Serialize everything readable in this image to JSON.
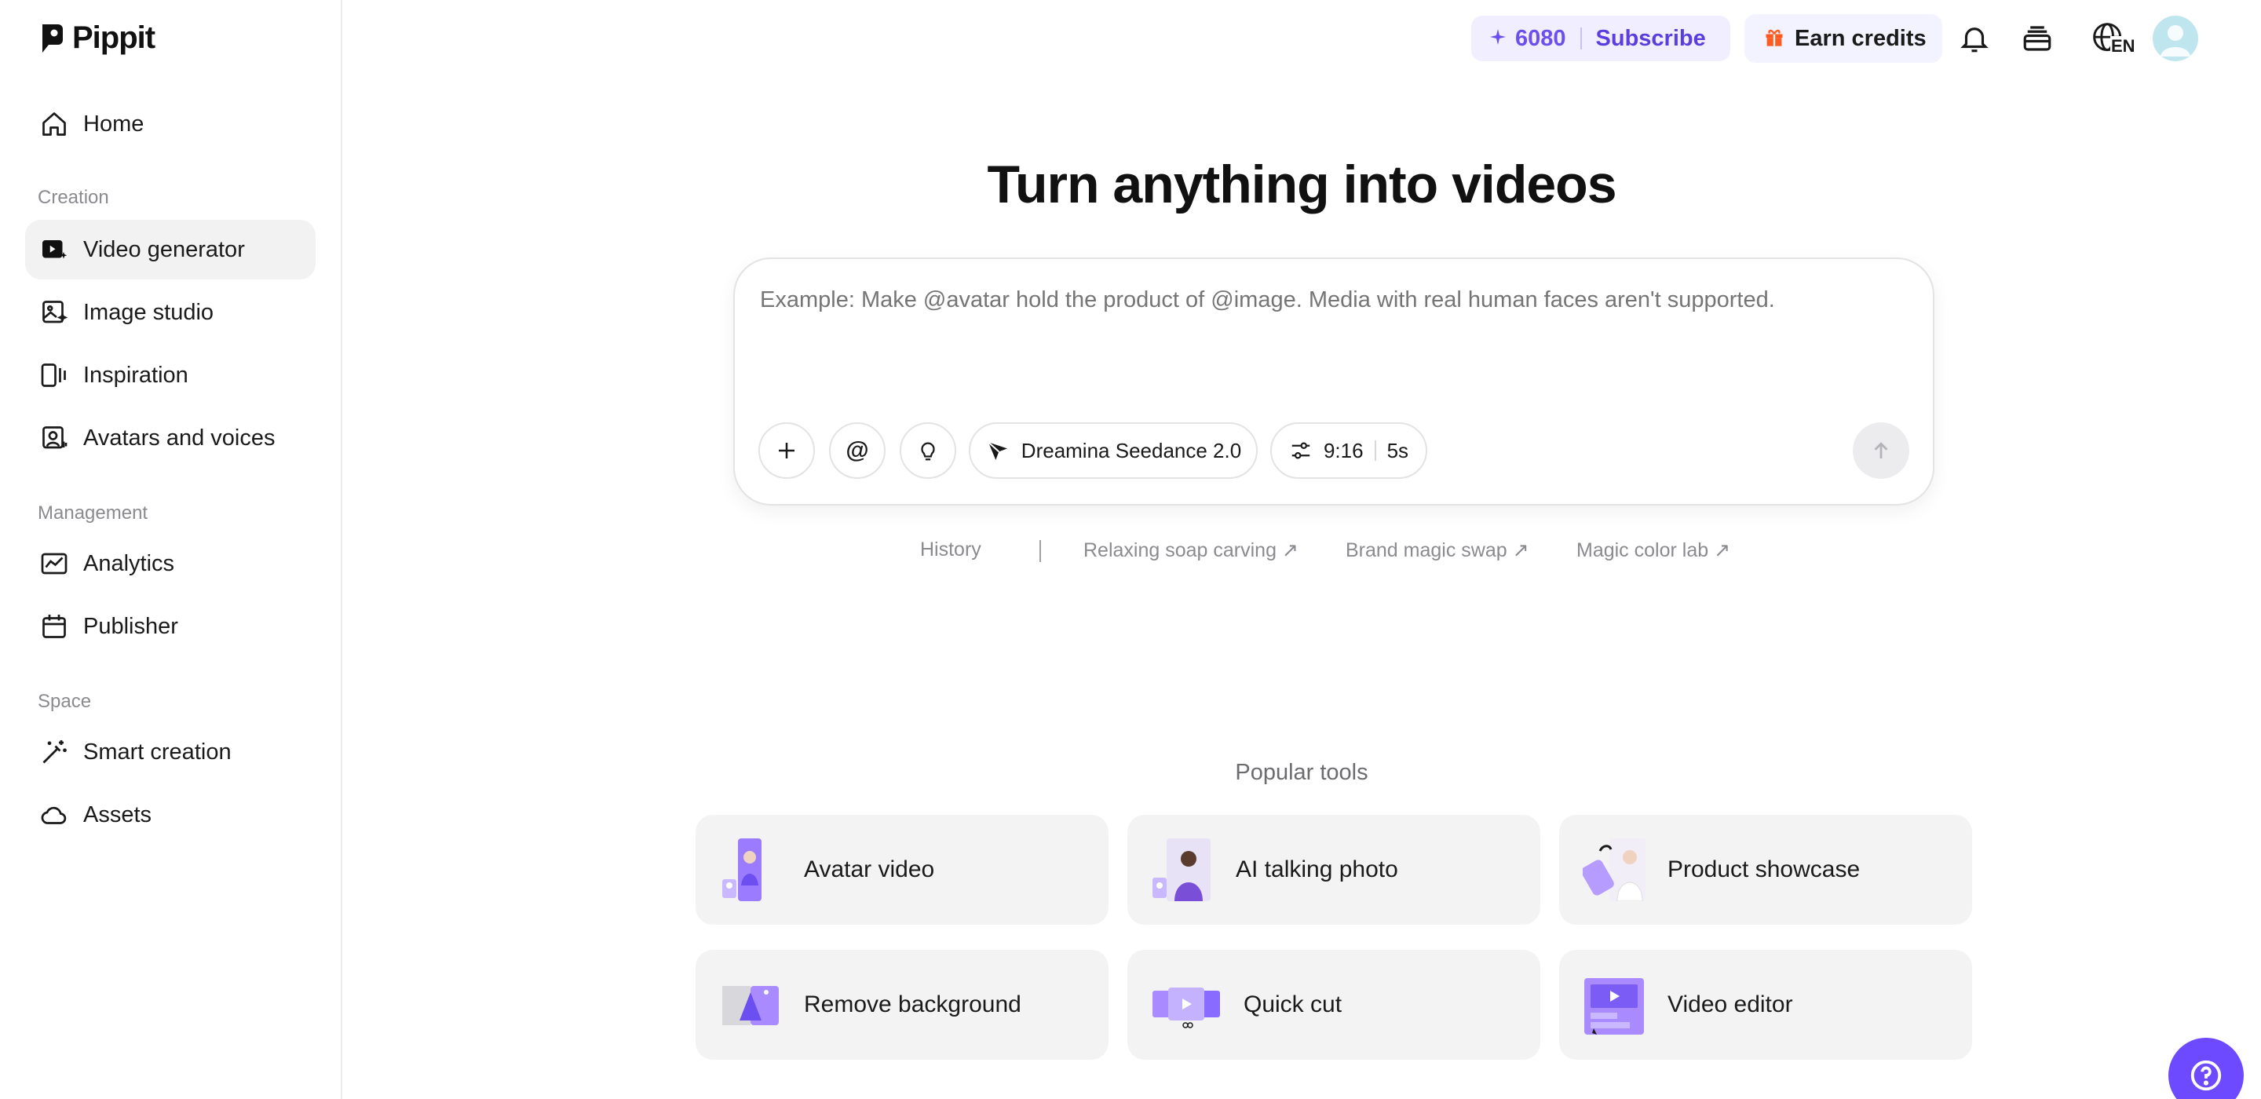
{
  "app": {
    "name": "Pippit"
  },
  "sidebar": {
    "home": "Home",
    "sections": {
      "creation": "Creation",
      "management": "Management",
      "space": "Space"
    },
    "items": [
      {
        "label": "Video generator",
        "icon": "video-generator-icon",
        "active": true
      },
      {
        "label": "Image studio",
        "icon": "image-studio-icon"
      },
      {
        "label": "Inspiration",
        "icon": "inspiration-icon"
      },
      {
        "label": "Avatars and voices",
        "icon": "avatar-voice-icon"
      },
      {
        "label": "Analytics",
        "icon": "analytics-icon"
      },
      {
        "label": "Publisher",
        "icon": "calendar-icon"
      },
      {
        "label": "Smart creation",
        "icon": "magic-wand-icon"
      },
      {
        "label": "Assets",
        "icon": "cloud-icon"
      }
    ]
  },
  "header": {
    "credits": "6080",
    "subscribe": "Subscribe",
    "earn_credits": "Earn credits",
    "language": "EN",
    "accent": "#6b4ff0"
  },
  "main": {
    "title": "Turn anything into videos",
    "prompt_placeholder": "Example: Make @avatar hold the product of @image. Media with real human faces aren't supported.",
    "model": "Dreamina Seedance 2.0",
    "ratio": "9:16",
    "duration": "5s",
    "suggestions": {
      "history": "History",
      "items": [
        "Relaxing soap carving ↗",
        "Brand magic swap ↗",
        "Magic color lab ↗"
      ]
    },
    "popular_title": "Popular tools",
    "tools": [
      "Avatar video",
      "AI talking photo",
      "Product showcase",
      "Remove background",
      "Quick cut",
      "Video editor"
    ]
  }
}
